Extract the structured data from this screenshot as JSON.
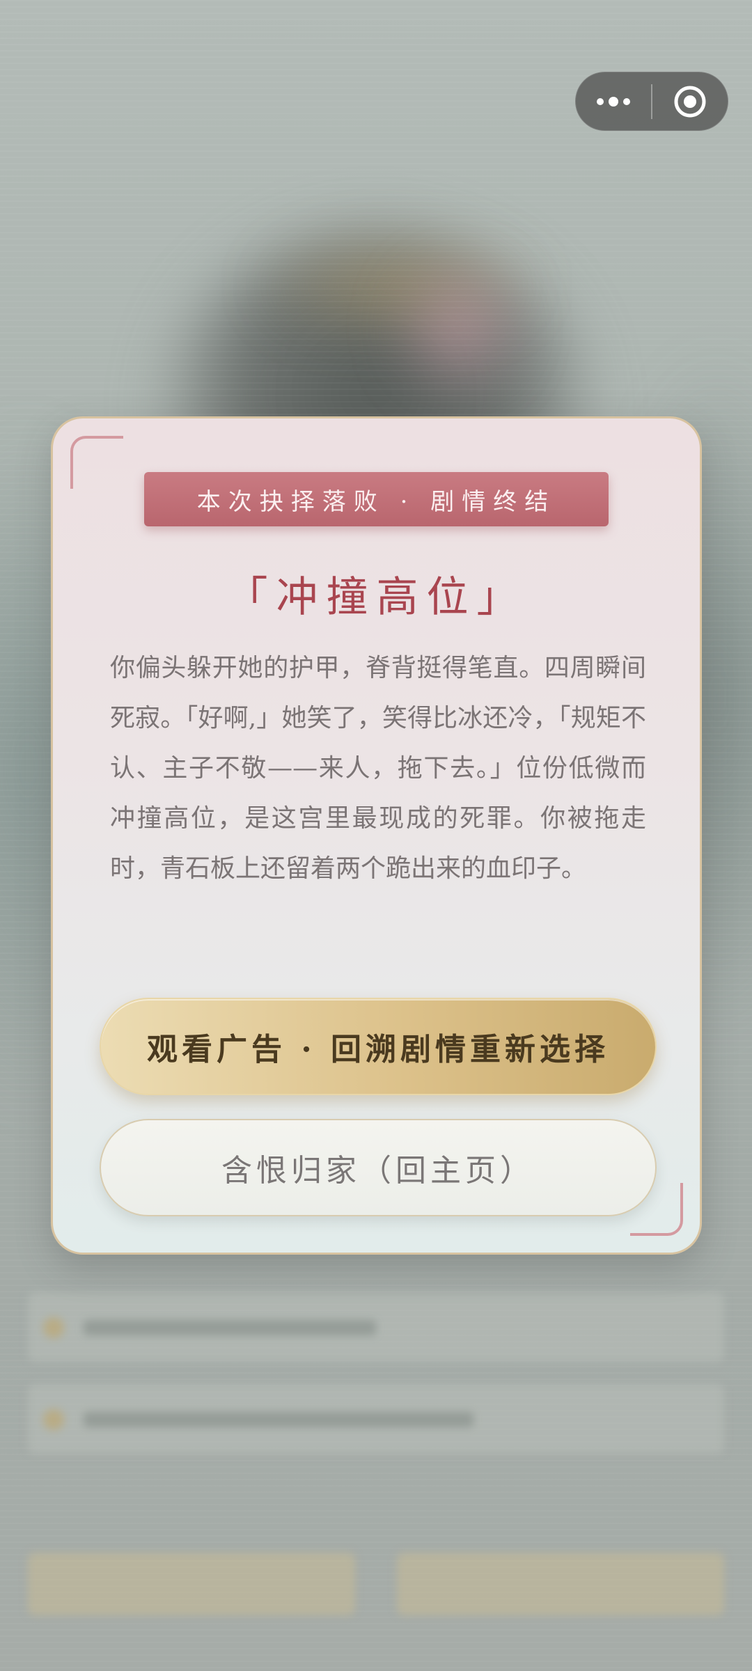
{
  "capsule": {
    "more_icon": "more-dots-icon",
    "close_icon": "target-circle-icon"
  },
  "modal": {
    "banner": "本次抉择落败 · 剧情终结",
    "title": "「冲撞高位」",
    "story": "你偏头躲开她的护甲，脊背挺得笔直。四周瞬间死寂。「好啊,」她笑了，笑得比冰还冷，「规矩不认、主子不敬——来人，拖下去。」位份低微而冲撞高位，是这宫里最现成的死罪。你被拖走时，青石板上还留着两个跪出来的血印子。",
    "primary_button": "观看广告 · 回溯剧情重新选择",
    "secondary_button": "含恨归家（回主页）"
  },
  "colors": {
    "banner": "#c06f77",
    "title": "#a9454f",
    "gold_button": "#dcc18a",
    "corner_accent": "#d49aa0"
  }
}
